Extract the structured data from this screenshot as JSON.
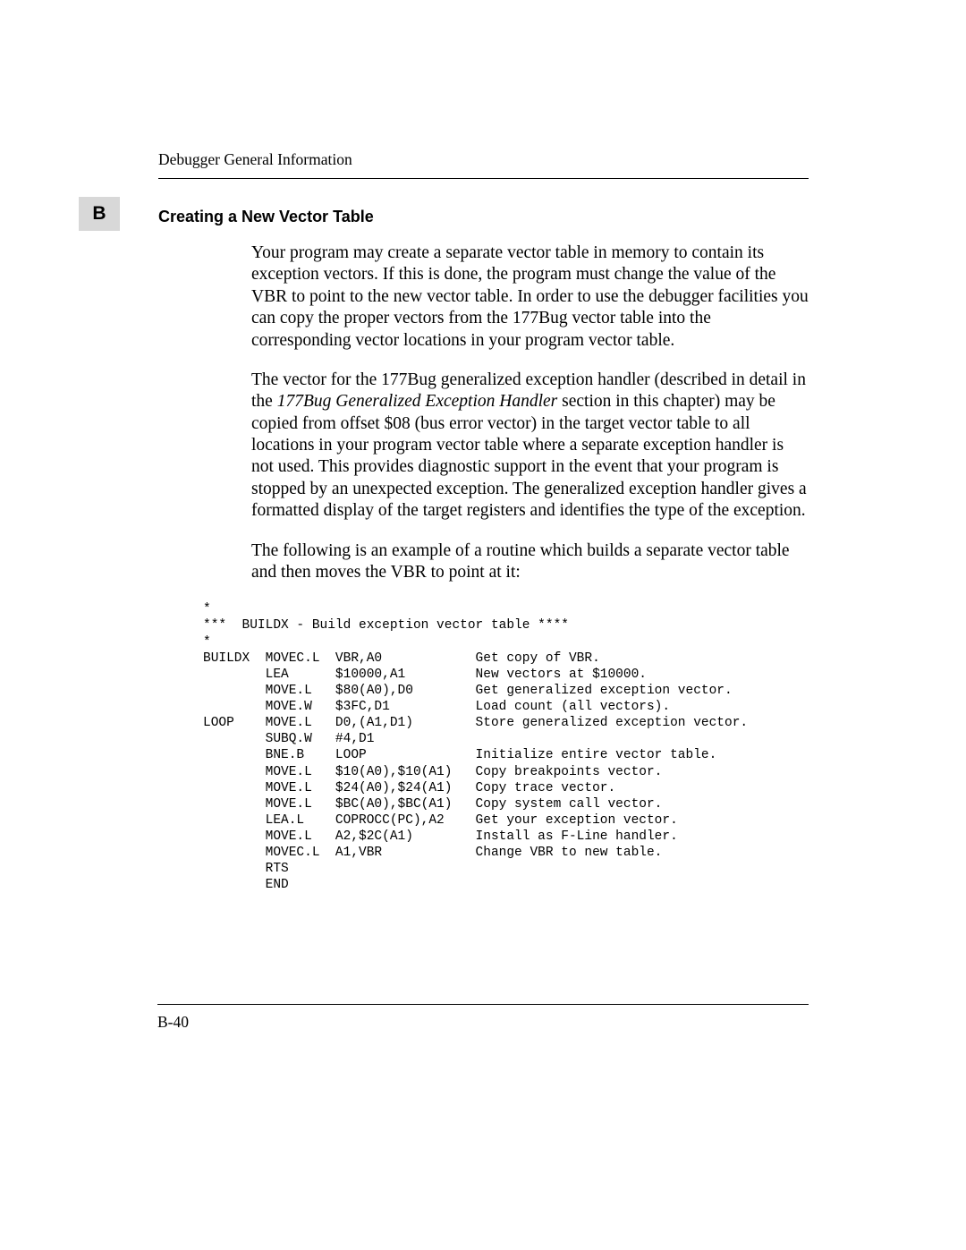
{
  "header": {
    "title": "Debugger General Information"
  },
  "section_tab": "B",
  "subheading": "Creating a New Vector Table",
  "paragraphs": {
    "p1": "Your program may create a separate vector table in memory to contain its exception vectors. If this is done, the program must change the value of the VBR to point to the new vector table. In order to use the debugger facilities you can copy the proper vectors from the 177Bug vector table into the corresponding vector locations in your program vector table.",
    "p2_a": "The vector for the 177Bug generalized exception handler (described in detail in the ",
    "p2_em": "177Bug Generalized Exception Handler",
    "p2_b": " section in this chapter) may be copied from offset $08 (bus error vector) in the target vector table to all locations in your program vector table where a separate exception handler is not used. This provides diagnostic support in the event that your program is stopped by an unexpected exception. The generalized exception handler gives a formatted display of the target registers and identifies the type of the exception.",
    "p3": "The following is an example of a routine which builds a separate vector table and then moves the VBR to point at it:"
  },
  "code": {
    "c01": "*",
    "c02": "***  BUILDX - Build exception vector table ****",
    "c03": "*",
    "c04": "BUILDX  MOVEC.L  VBR,A0            Get copy of VBR.",
    "c05": "        LEA      $10000,A1         New vectors at $10000.",
    "c06": "        MOVE.L   $80(A0),D0        Get generalized exception vector.",
    "c07": "        MOVE.W   $3FC,D1           Load count (all vectors).",
    "c08": "LOOP    MOVE.L   D0,(A1,D1)        Store generalized exception vector.",
    "c09": "        SUBQ.W   #4,D1",
    "c10": "        BNE.B    LOOP              Initialize entire vector table.",
    "c11": "        MOVE.L   $10(A0),$10(A1)   Copy breakpoints vector.",
    "c12": "        MOVE.L   $24(A0),$24(A1)   Copy trace vector.",
    "c13": "        MOVE.L   $BC(A0),$BC(A1)   Copy system call vector.",
    "c14": "        LEA.L    COPROCC(PC),A2    Get your exception vector.",
    "c15": "        MOVE.L   A2,$2C(A1)        Install as F-Line handler.",
    "c16": "        MOVEC.L  A1,VBR            Change VBR to new table.",
    "c17": "        RTS",
    "c18": "        END"
  },
  "page_number": "B-40"
}
